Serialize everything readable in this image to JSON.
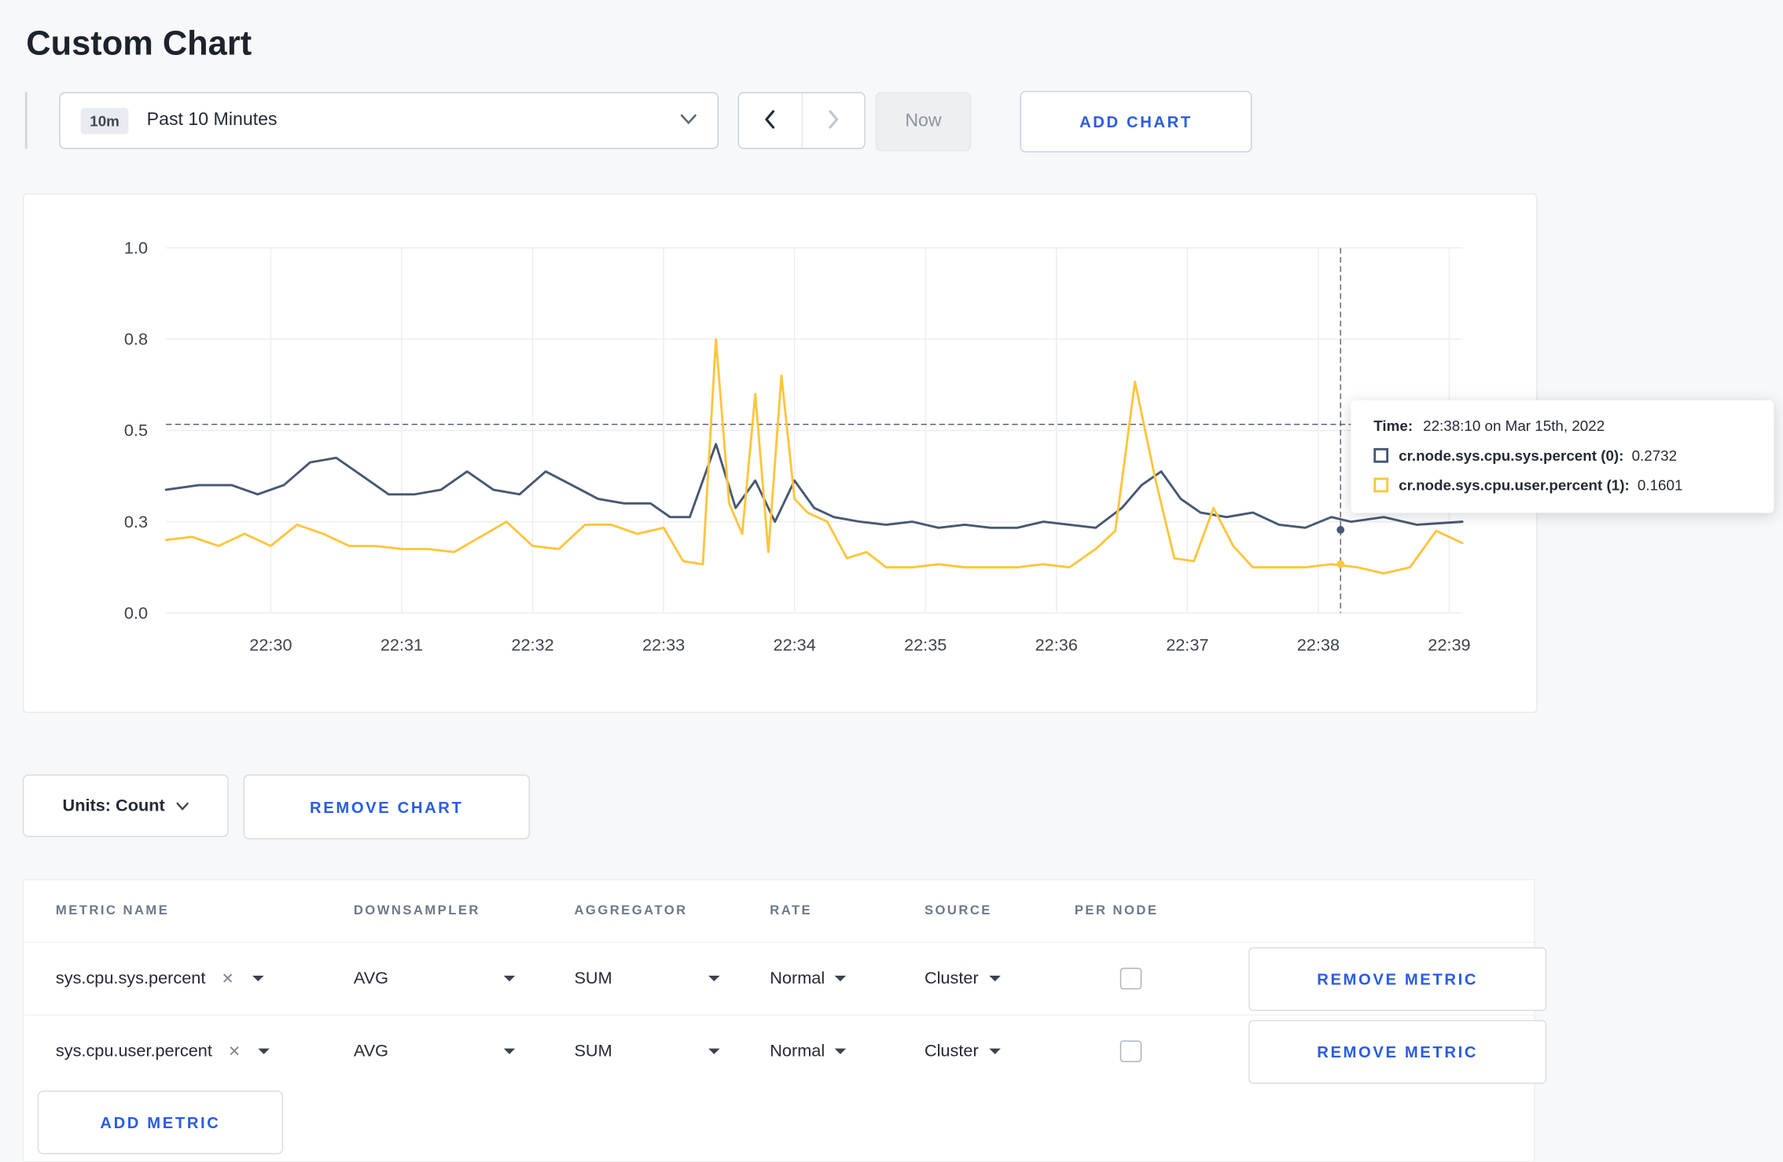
{
  "page": {
    "title": "Custom Chart"
  },
  "colors": {
    "accent_blue": "#2a5ce4",
    "series_sys": "#475872",
    "series_user": "#ffc53d",
    "background": "#f7f8fa"
  },
  "toolbar": {
    "time_badge": "10m",
    "time_label": "Past 10 Minutes",
    "now_label": "Now",
    "add_chart_label": "ADD CHART"
  },
  "chart": {
    "tooltip": {
      "time_label": "Time:",
      "time_value": "22:38:10 on Mar 15th, 2022",
      "series": [
        {
          "label": "cr.node.sys.cpu.sys.percent (0):",
          "value": "0.2732",
          "color": "#475872"
        },
        {
          "label": "cr.node.sys.cpu.user.percent (1):",
          "value": "0.1601",
          "color": "#ffc53d"
        }
      ]
    }
  },
  "chart_data": {
    "type": "line",
    "title": "",
    "xlabel": "",
    "ylabel": "",
    "x_range": [
      -0.8,
      9.1
    ],
    "x_ticks": [
      {
        "minute": 0,
        "label": "22:30"
      },
      {
        "minute": 1,
        "label": "22:31"
      },
      {
        "minute": 2,
        "label": "22:32"
      },
      {
        "minute": 3,
        "label": "22:33"
      },
      {
        "minute": 4,
        "label": "22:34"
      },
      {
        "minute": 5,
        "label": "22:35"
      },
      {
        "minute": 6,
        "label": "22:36"
      },
      {
        "minute": 7,
        "label": "22:37"
      },
      {
        "minute": 8,
        "label": "22:38"
      },
      {
        "minute": 9,
        "label": "22:39"
      }
    ],
    "y_ticks": [
      {
        "value": 0.0,
        "label": "0.0"
      },
      {
        "value": 0.3,
        "label": "0.3"
      },
      {
        "value": 0.5,
        "label": "0.5"
      },
      {
        "value": 0.8,
        "label": "0.8"
      },
      {
        "value": 1.0,
        "label": "1.0"
      }
    ],
    "grid": true,
    "legend_position": "tooltip-right",
    "crosshair": {
      "minute": 8.17,
      "value": 0.52,
      "time": "22:38:10"
    },
    "hover_points": [
      {
        "minute": 8.17,
        "value": 0.2732,
        "series": 0
      },
      {
        "minute": 8.17,
        "value": 0.1601,
        "series": 1
      }
    ],
    "series": [
      {
        "name": "cr.node.sys.cpu.sys.percent",
        "color": "#475872",
        "x": [
          -0.8,
          -0.55,
          -0.3,
          -0.1,
          0.1,
          0.3,
          0.5,
          0.7,
          0.9,
          1.1,
          1.3,
          1.5,
          1.7,
          1.9,
          2.1,
          2.3,
          2.5,
          2.7,
          2.9,
          3.05,
          3.2,
          3.4,
          3.55,
          3.7,
          3.85,
          4.0,
          4.15,
          4.3,
          4.5,
          4.7,
          4.9,
          5.1,
          5.3,
          5.5,
          5.7,
          5.9,
          6.1,
          6.3,
          6.5,
          6.65,
          6.8,
          6.95,
          7.1,
          7.3,
          7.5,
          7.7,
          7.9,
          8.1,
          8.25,
          8.5,
          8.75,
          9.1
        ],
        "y": [
          0.37,
          0.38,
          0.38,
          0.36,
          0.38,
          0.43,
          0.44,
          0.4,
          0.36,
          0.36,
          0.37,
          0.41,
          0.37,
          0.36,
          0.41,
          0.38,
          0.35,
          0.34,
          0.34,
          0.31,
          0.31,
          0.47,
          0.33,
          0.39,
          0.3,
          0.39,
          0.33,
          0.31,
          0.3,
          0.29,
          0.3,
          0.28,
          0.29,
          0.28,
          0.28,
          0.3,
          0.29,
          0.28,
          0.33,
          0.38,
          0.41,
          0.35,
          0.32,
          0.31,
          0.32,
          0.29,
          0.28,
          0.31,
          0.3,
          0.31,
          0.29,
          0.3
        ]
      },
      {
        "name": "cr.node.sys.cpu.user.percent",
        "color": "#ffc53d",
        "x": [
          -0.8,
          -0.6,
          -0.4,
          -0.2,
          0.0,
          0.2,
          0.4,
          0.6,
          0.8,
          1.0,
          1.2,
          1.4,
          1.6,
          1.8,
          2.0,
          2.2,
          2.4,
          2.6,
          2.8,
          3.0,
          3.15,
          3.3,
          3.4,
          3.5,
          3.6,
          3.7,
          3.8,
          3.9,
          4.0,
          4.1,
          4.25,
          4.4,
          4.55,
          4.7,
          4.9,
          5.1,
          5.3,
          5.5,
          5.7,
          5.9,
          6.1,
          6.3,
          6.45,
          6.6,
          6.75,
          6.9,
          7.05,
          7.2,
          7.35,
          7.5,
          7.7,
          7.9,
          8.1,
          8.3,
          8.5,
          8.7,
          8.9,
          9.1
        ],
        "y": [
          0.24,
          0.25,
          0.22,
          0.26,
          0.22,
          0.29,
          0.26,
          0.22,
          0.22,
          0.21,
          0.21,
          0.2,
          0.25,
          0.3,
          0.22,
          0.21,
          0.29,
          0.29,
          0.26,
          0.28,
          0.17,
          0.16,
          0.8,
          0.34,
          0.26,
          0.62,
          0.2,
          0.68,
          0.35,
          0.32,
          0.3,
          0.18,
          0.2,
          0.15,
          0.15,
          0.16,
          0.15,
          0.15,
          0.15,
          0.16,
          0.15,
          0.21,
          0.27,
          0.66,
          0.4,
          0.18,
          0.17,
          0.33,
          0.22,
          0.15,
          0.15,
          0.15,
          0.16,
          0.15,
          0.13,
          0.15,
          0.27,
          0.23
        ]
      }
    ]
  },
  "controls": {
    "units_label": "Units: Count",
    "remove_chart_label": "REMOVE CHART",
    "add_metric_label": "ADD METRIC"
  },
  "metrics_table": {
    "headers": [
      "METRIC NAME",
      "DOWNSAMPLER",
      "AGGREGATOR",
      "RATE",
      "SOURCE",
      "PER NODE"
    ],
    "rows": [
      {
        "metric": "sys.cpu.sys.percent",
        "downsampler": "AVG",
        "aggregator": "SUM",
        "rate": "Normal",
        "source": "Cluster",
        "per_node": false,
        "remove_label": "REMOVE METRIC"
      },
      {
        "metric": "sys.cpu.user.percent",
        "downsampler": "AVG",
        "aggregator": "SUM",
        "rate": "Normal",
        "source": "Cluster",
        "per_node": false,
        "remove_label": "REMOVE METRIC"
      }
    ]
  }
}
